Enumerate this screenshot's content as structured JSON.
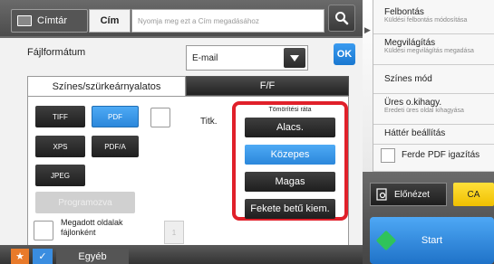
{
  "topbar": {
    "address_book_label": "Címtár",
    "address_label": "Cím",
    "address_placeholder": "Nyomja meg ezt a Cím megadásához"
  },
  "file_format": {
    "label": "Fájlformátum",
    "selected": "E-mail",
    "ok_label": "OK"
  },
  "tabs": {
    "color": "Színes/szürkeárnyalatos",
    "bw": "F/F"
  },
  "formats": {
    "tiff": "TIFF",
    "pdf": "PDF",
    "xps": "XPS",
    "pdfa": "PDF/A",
    "jpeg": "JPEG",
    "programmed": "Programozva",
    "encrypt_label": "Titk."
  },
  "compression": {
    "title": "Tömörítési ráta",
    "low": "Alacs.",
    "medium": "Közepes",
    "high": "Magas",
    "black_text": "Fekete betű kiem.",
    "selected": "Közepes"
  },
  "split": {
    "label_line1": "Megadott oldalak",
    "label_line2": "fájlonként",
    "page_value": "1"
  },
  "bottom": {
    "other_label": "Egyéb"
  },
  "right_panel": {
    "items": [
      {
        "title": "Felbontás",
        "sub": "Küldési felbontás módosítása"
      },
      {
        "title": "Megvilágítás",
        "sub": "Küldési megvilágítás megadása"
      },
      {
        "title": "Színes mód",
        "sub": ""
      },
      {
        "title": "Üres o.kihagy.",
        "sub": "Eredeti üres oldal kihagyása"
      },
      {
        "title": "Háttér beállítás",
        "sub": ""
      }
    ],
    "pdf_compact_label": "Ferde PDF igazítás",
    "preview_label": "Előnézet",
    "ca_label": "CA",
    "start_label": "Start"
  },
  "colors": {
    "accent_blue": "#2b87db",
    "highlight_red": "#e0202a",
    "ca_yellow": "#f0c000"
  }
}
